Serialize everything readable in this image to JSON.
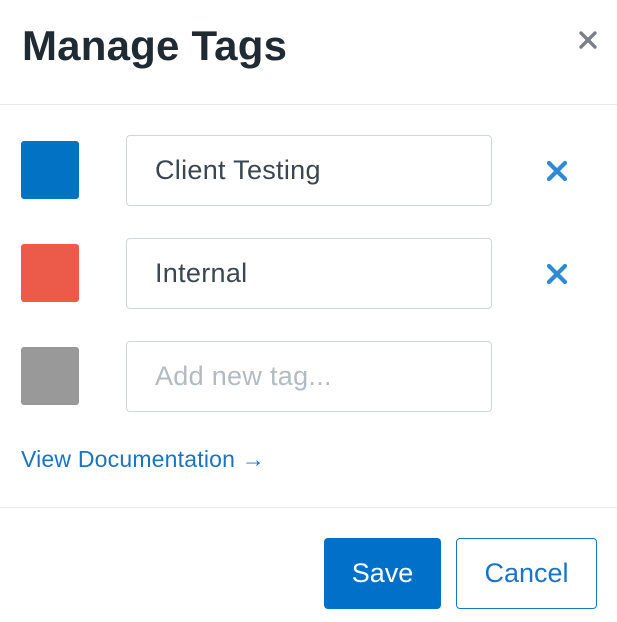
{
  "dialog": {
    "title": "Manage Tags",
    "close_icon": "close-icon"
  },
  "tags": [
    {
      "color": "#0272c4",
      "value": "Client Testing",
      "remove_icon": "close-icon"
    },
    {
      "color": "#ec5a4a",
      "value": "Internal",
      "remove_icon": "close-icon"
    }
  ],
  "new_tag": {
    "color": "#999999",
    "placeholder": "Add new tag..."
  },
  "documentation_link": "View Documentation →",
  "footer": {
    "save_label": "Save",
    "cancel_label": "Cancel"
  },
  "colors": {
    "accent": "#0070c9",
    "link": "#1a74c6",
    "remove_icon": "#2f8ad6",
    "close_icon": "#7a8086"
  }
}
